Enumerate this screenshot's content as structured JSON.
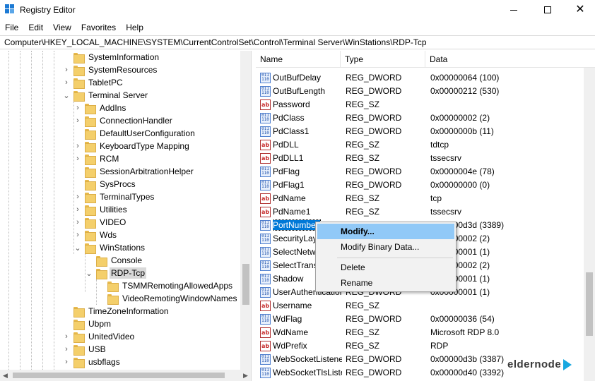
{
  "window": {
    "title": "Registry Editor",
    "minimize": "—",
    "maximize": "□",
    "close": "✕"
  },
  "menu": [
    "File",
    "Edit",
    "View",
    "Favorites",
    "Help"
  ],
  "address": "Computer\\HKEY_LOCAL_MACHINE\\SYSTEM\\CurrentControlSet\\Control\\Terminal Server\\WinStations\\RDP-Tcp",
  "tree": [
    {
      "label": "SystemInformation",
      "expander": ""
    },
    {
      "label": "SystemResources",
      "expander": "›"
    },
    {
      "label": "TabletPC",
      "expander": "›"
    },
    {
      "label": "Terminal Server",
      "expander": "⌄"
    },
    {
      "label": "AddIns",
      "expander": "›"
    },
    {
      "label": "ConnectionHandler",
      "expander": "›"
    },
    {
      "label": "DefaultUserConfiguration",
      "expander": ""
    },
    {
      "label": "KeyboardType Mapping",
      "expander": "›"
    },
    {
      "label": "RCM",
      "expander": "›"
    },
    {
      "label": "SessionArbitrationHelper",
      "expander": ""
    },
    {
      "label": "SysProcs",
      "expander": ""
    },
    {
      "label": "TerminalTypes",
      "expander": "›"
    },
    {
      "label": "Utilities",
      "expander": "›"
    },
    {
      "label": "VIDEO",
      "expander": "›"
    },
    {
      "label": "Wds",
      "expander": "›"
    },
    {
      "label": "WinStations",
      "expander": "⌄"
    },
    {
      "label": "Console",
      "expander": ""
    },
    {
      "label": "RDP-Tcp",
      "expander": "⌄",
      "selected": true
    },
    {
      "label": "TSMMRemotingAllowedApps",
      "expander": ""
    },
    {
      "label": "VideoRemotingWindowNames",
      "expander": ""
    },
    {
      "label": "TimeZoneInformation",
      "expander": ""
    },
    {
      "label": "Ubpm",
      "expander": ""
    },
    {
      "label": "UnitedVideo",
      "expander": "›"
    },
    {
      "label": "USB",
      "expander": "›"
    },
    {
      "label": "usbflags",
      "expander": "›"
    }
  ],
  "columns": {
    "name": "Name",
    "type": "Type",
    "data": "Data"
  },
  "values": [
    {
      "name": "OutBufDelay",
      "type": "REG_DWORD",
      "data": "0x00000064 (100)",
      "icon": "binary-value-icon"
    },
    {
      "name": "OutBufLength",
      "type": "REG_DWORD",
      "data": "0x00000212 (530)",
      "icon": "binary-value-icon"
    },
    {
      "name": "Password",
      "type": "REG_SZ",
      "data": "",
      "icon": "string-value-icon"
    },
    {
      "name": "PdClass",
      "type": "REG_DWORD",
      "data": "0x00000002 (2)",
      "icon": "binary-value-icon"
    },
    {
      "name": "PdClass1",
      "type": "REG_DWORD",
      "data": "0x0000000b (11)",
      "icon": "binary-value-icon"
    },
    {
      "name": "PdDLL",
      "type": "REG_SZ",
      "data": "tdtcp",
      "icon": "string-value-icon"
    },
    {
      "name": "PdDLL1",
      "type": "REG_SZ",
      "data": "tssecsrv",
      "icon": "string-value-icon"
    },
    {
      "name": "PdFlag",
      "type": "REG_DWORD",
      "data": "0x0000004e (78)",
      "icon": "binary-value-icon"
    },
    {
      "name": "PdFlag1",
      "type": "REG_DWORD",
      "data": "0x00000000 (0)",
      "icon": "binary-value-icon"
    },
    {
      "name": "PdName",
      "type": "REG_SZ",
      "data": "tcp",
      "icon": "string-value-icon"
    },
    {
      "name": "PdName1",
      "type": "REG_SZ",
      "data": "tssecsrv",
      "icon": "string-value-icon"
    },
    {
      "name": "PortNumber",
      "type": "REG_DWORD",
      "data": "0x00000d3d (3389)",
      "icon": "binary-value-icon",
      "selected": true
    },
    {
      "name": "SecurityLayer",
      "type": "REG_DWORD",
      "data": "0x00000002 (2)",
      "icon": "binary-value-icon"
    },
    {
      "name": "SelectNetworkDetect",
      "type": "REG_DWORD",
      "data": "0x00000001 (1)",
      "icon": "binary-value-icon"
    },
    {
      "name": "SelectTransport",
      "type": "REG_DWORD",
      "data": "0x00000002 (2)",
      "icon": "binary-value-icon"
    },
    {
      "name": "Shadow",
      "type": "REG_DWORD",
      "data": "0x00000001 (1)",
      "icon": "binary-value-icon"
    },
    {
      "name": "UserAuthentication",
      "type": "REG_DWORD",
      "data": "0x00000001 (1)",
      "icon": "binary-value-icon"
    },
    {
      "name": "Username",
      "type": "REG_SZ",
      "data": "",
      "icon": "string-value-icon"
    },
    {
      "name": "WdFlag",
      "type": "REG_DWORD",
      "data": "0x00000036 (54)",
      "icon": "binary-value-icon"
    },
    {
      "name": "WdName",
      "type": "REG_SZ",
      "data": "Microsoft RDP 8.0",
      "icon": "string-value-icon"
    },
    {
      "name": "WdPrefix",
      "type": "REG_SZ",
      "data": "RDP",
      "icon": "string-value-icon"
    },
    {
      "name": "WebSocketListenerPort",
      "type": "REG_DWORD",
      "data": "0x00000d3b (3387)",
      "icon": "binary-value-icon"
    },
    {
      "name": "WebSocketTlsListenerPort",
      "type": "REG_DWORD",
      "data": "0x00000d40 (3392)",
      "icon": "binary-value-icon"
    }
  ],
  "context_menu": {
    "items": [
      "Modify...",
      "Modify Binary Data...",
      "Delete",
      "Rename"
    ],
    "highlighted": "Modify..."
  },
  "icons": {
    "binary_glyph": "011\n110",
    "string_glyph": "ab"
  },
  "watermark": "eldernode",
  "colors": {
    "selection": "#0078d7",
    "menu_highlight": "#91c9f7",
    "folder": "#f4cf6b"
  }
}
